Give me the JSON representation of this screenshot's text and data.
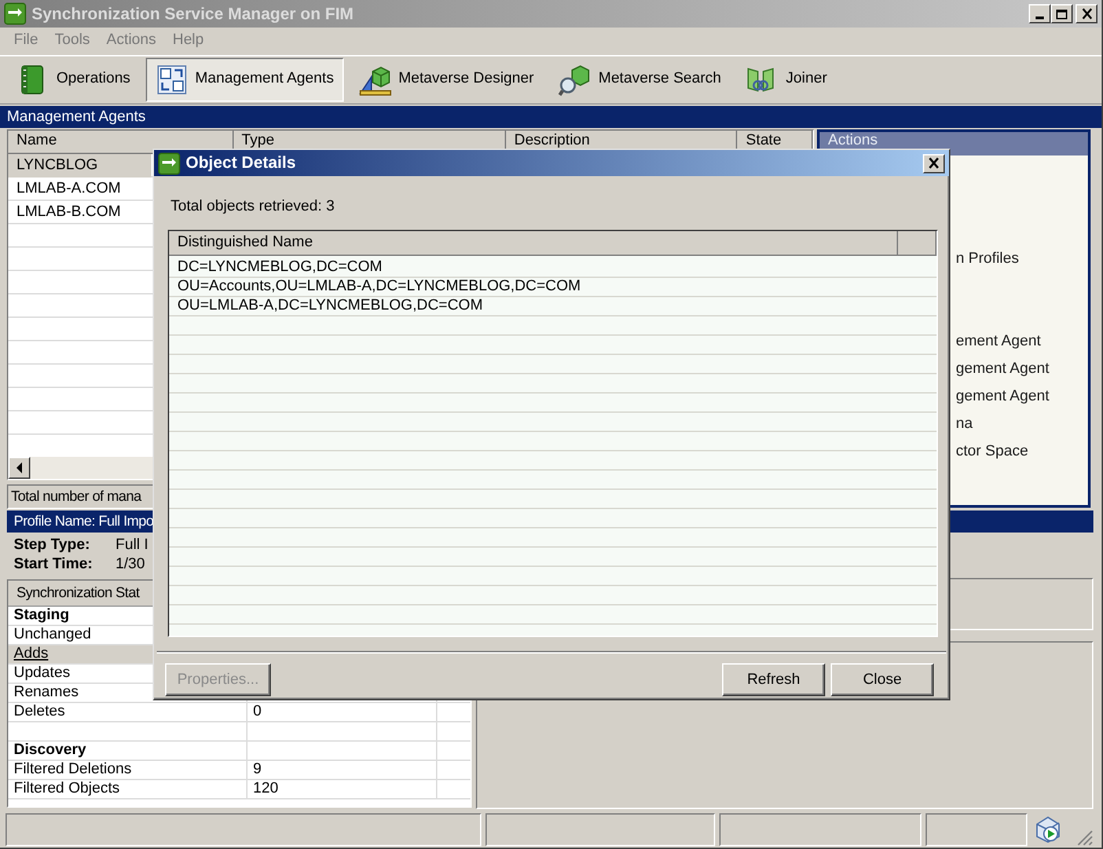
{
  "window": {
    "title": "Synchronization Service Manager on FIM"
  },
  "menu": [
    "File",
    "Tools",
    "Actions",
    "Help"
  ],
  "toolbar": [
    {
      "label": "Operations",
      "selected": false
    },
    {
      "label": "Management Agents",
      "selected": true
    },
    {
      "label": "Metaverse Designer",
      "selected": false
    },
    {
      "label": "Metaverse Search",
      "selected": false
    },
    {
      "label": "Joiner",
      "selected": false
    }
  ],
  "management_agents": {
    "title": "Management Agents",
    "columns": [
      "Name",
      "Type",
      "Description",
      "State"
    ],
    "rows": [
      {
        "name": "LYNCBLOG",
        "selected": true
      },
      {
        "name": "LMLAB-A.COM",
        "selected": false
      },
      {
        "name": "LMLAB-B.COM",
        "selected": false
      }
    ],
    "status": "Total number of mana"
  },
  "actions": {
    "title": "Actions",
    "groups": [
      [
        "n Profiles"
      ],
      [
        "ement Agent",
        "gement Agent",
        "gement Agent",
        "na",
        "ctor Space"
      ]
    ]
  },
  "profile": {
    "title": "Profile Name: Full Impo",
    "fields": [
      {
        "label": "Step Type:",
        "value": "Full I"
      },
      {
        "label": "Start Time:",
        "value": "1/30"
      }
    ]
  },
  "statistics": {
    "header": "Synchronization Stat",
    "rows": [
      {
        "kind": "section",
        "label": "Staging",
        "selected": false
      },
      {
        "kind": "row",
        "label": "Unchanged",
        "selected": false
      },
      {
        "kind": "link",
        "label": "Adds",
        "selected": true
      },
      {
        "kind": "row",
        "label": "Updates",
        "selected": false
      },
      {
        "kind": "row",
        "label": "Renames",
        "selected": false
      },
      {
        "kind": "row",
        "label": "Deletes",
        "value": "0",
        "selected": false
      },
      {
        "kind": "blank",
        "selected": false
      },
      {
        "kind": "section",
        "label": "Discovery",
        "selected": false
      },
      {
        "kind": "row",
        "label": "Filtered Deletions",
        "value": "9",
        "selected": false
      },
      {
        "kind": "row",
        "label": "Filtered Objects",
        "value": "120",
        "selected": false
      }
    ]
  },
  "dialog": {
    "title": "Object Details",
    "summary": "Total objects retrieved: 3",
    "columns": [
      "Distinguished Name"
    ],
    "rows": [
      "DC=LYNCMEBLOG,DC=COM",
      "OU=Accounts,OU=LMLAB-A,DC=LYNCMEBLOG,DC=COM",
      "OU=LMLAB-A,DC=LYNCMEBLOG,DC=COM"
    ],
    "buttons": [
      {
        "label": "Properties...",
        "disabled": true
      },
      {
        "label": "Refresh",
        "disabled": false
      },
      {
        "label": "Close",
        "disabled": false
      }
    ]
  }
}
